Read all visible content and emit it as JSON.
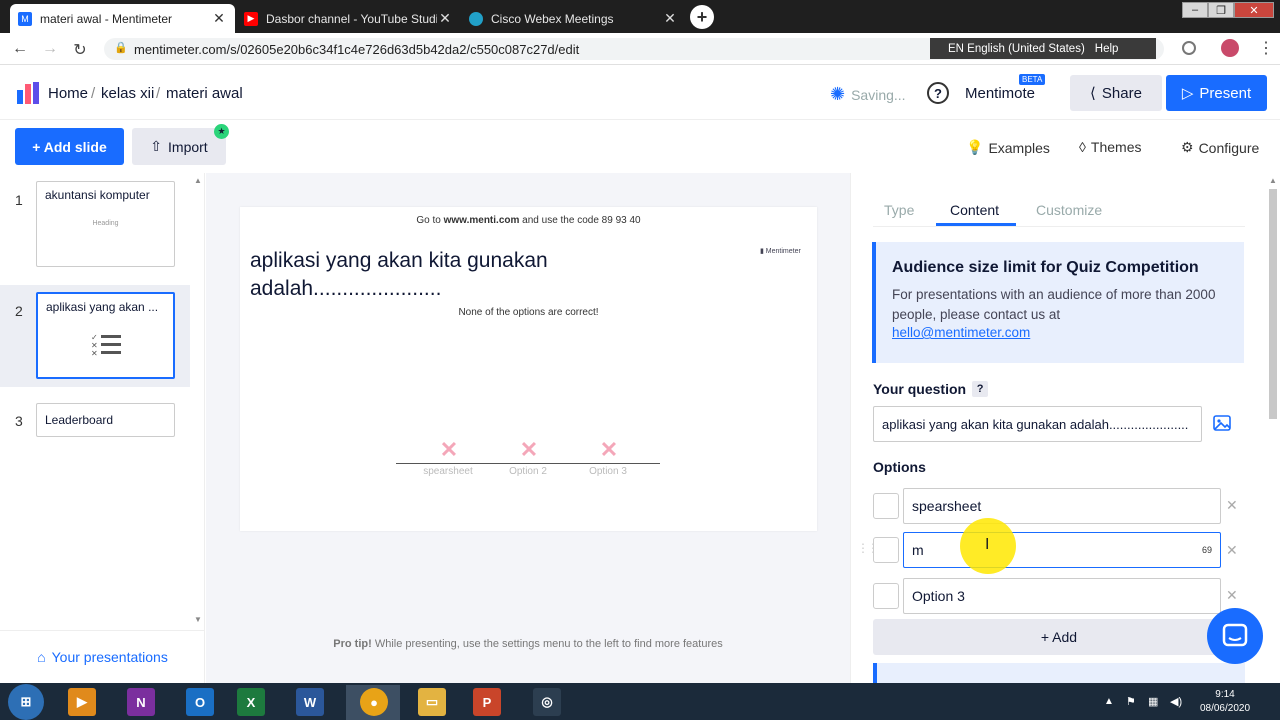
{
  "browser": {
    "tabs": [
      {
        "title": "materi awal - Mentimeter",
        "icon": "mentimeter-icon",
        "active": true
      },
      {
        "title": "Dasbor channel - YouTube Studio",
        "icon": "youtube-icon",
        "active": false
      },
      {
        "title": "Cisco Webex Meetings",
        "icon": "webex-icon",
        "active": false
      }
    ],
    "new_tab": "+",
    "url": "mentimeter.com/s/02605e20b6c34f1c4e726d63d5b42da2/c550c087c27d/edit",
    "lang_label": "EN English (United States)",
    "help_label": "Help"
  },
  "header": {
    "breadcrumb": [
      "Home",
      "/",
      "kelas xii",
      "/",
      "materi awal"
    ],
    "saving": "Saving...",
    "help": "?",
    "mentimote": "Mentimote",
    "beta": "BETA",
    "share": "Share",
    "present": "Present"
  },
  "toolbar": {
    "add_slide": "+ Add slide",
    "import": "Import",
    "examples": "Examples",
    "themes": "Themes",
    "configure": "Configure"
  },
  "slides": [
    {
      "num": "1",
      "title": "akuntansi komputer",
      "sub": "Heading"
    },
    {
      "num": "2",
      "title": "aplikasi yang akan ..."
    },
    {
      "num": "3",
      "title": "Leaderboard"
    }
  ],
  "your_presentations": "Your presentations",
  "preview": {
    "goto_pre": "Go to ",
    "goto_site": "www.menti.com",
    "goto_post": " and use the code 89 93 40",
    "question": "aplikasi yang akan kita gunakan adalah......................",
    "logo": "Mentimeter",
    "none_correct": "None of the options are correct!",
    "options": [
      "spearsheet",
      "Option 2",
      "Option 3"
    ],
    "mark": "✕"
  },
  "pro_tip_bold": "Pro tip!",
  "pro_tip": " While presenting, use the settings menu to the left to find more features",
  "right": {
    "tabs": [
      "Type",
      "Content",
      "Customize"
    ],
    "info_title": "Audience size limit for Quiz Competition",
    "info_text": "For presentations with an audience of more than 2000 people, please contact us at",
    "info_link": "hello@mentimeter.com",
    "question_label": "Your question",
    "question_help": "?",
    "question_value": "aplikasi yang akan kita gunakan adalah......................",
    "options_label": "Options",
    "options": [
      "spearsheet",
      "m",
      "Option 3"
    ],
    "char_count": "69",
    "add": "+ Add"
  },
  "taskbar": {
    "time": "9:14",
    "date": "08/06/2020"
  },
  "colors": {
    "accent": "#196cff",
    "pink_mark": "#f4a7b9"
  }
}
